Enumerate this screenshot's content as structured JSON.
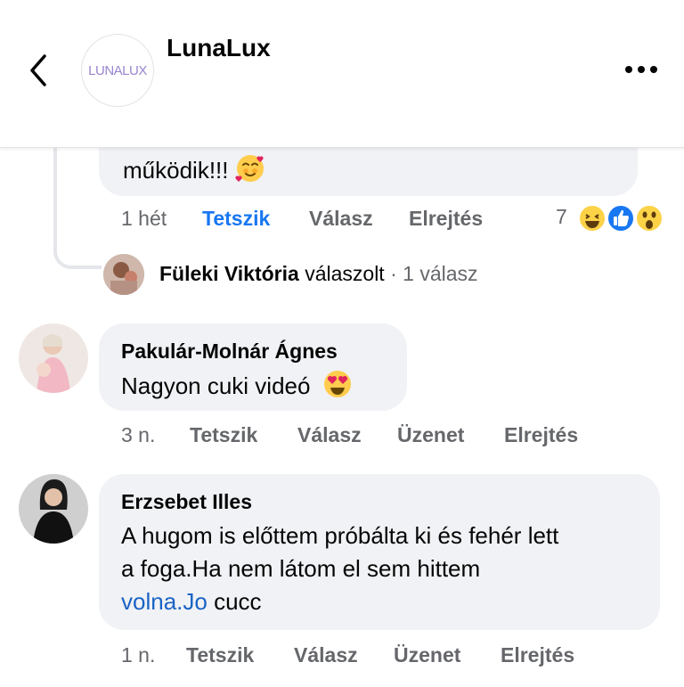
{
  "header": {
    "page_name": "LunaLux",
    "logo_text": "LUNALUX",
    "back_icon": "chevron-left-icon",
    "more_icon": "more-horizontal-icon"
  },
  "comments": [
    {
      "text_tail": "működik!!!",
      "emoji": "smiling-face-with-hearts",
      "actions": {
        "time": "1 hét",
        "like": "Tetszik",
        "reply": "Válasz",
        "hide": "Elrejtés"
      },
      "like_active": true,
      "reactions": {
        "count": "7",
        "icons": [
          "haha-reaction",
          "like-reaction",
          "wow-reaction"
        ]
      },
      "reply_summary": {
        "name": "Füleki Viktória",
        "verb": "válaszolt",
        "separator": "·",
        "count": "1 válasz"
      }
    },
    {
      "author": "Pakulár-Molnár Ágnes",
      "text": "Nagyon cuki videó",
      "emoji": "heart-eyes",
      "actions": {
        "time": "3 n.",
        "like": "Tetszik",
        "reply": "Válasz",
        "message": "Üzenet",
        "hide": "Elrejtés"
      }
    },
    {
      "author": "Erzsebet Illes",
      "text_lines": [
        "A hugom is előttem próbálta ki és fehér lett",
        "a foga.Ha nem látom el sem hittem"
      ],
      "link": "volna.Jo",
      "text_after_link": " cucc",
      "actions": {
        "time": "1 n.",
        "like": "Tetszik",
        "reply": "Válasz",
        "message": "Üzenet",
        "hide": "Elrejtés"
      }
    }
  ],
  "colors": {
    "like_blue": "#1877f2",
    "link_blue": "#1a63c5",
    "muted_gray": "#65676b",
    "bubble_bg": "#f0f2f5"
  }
}
